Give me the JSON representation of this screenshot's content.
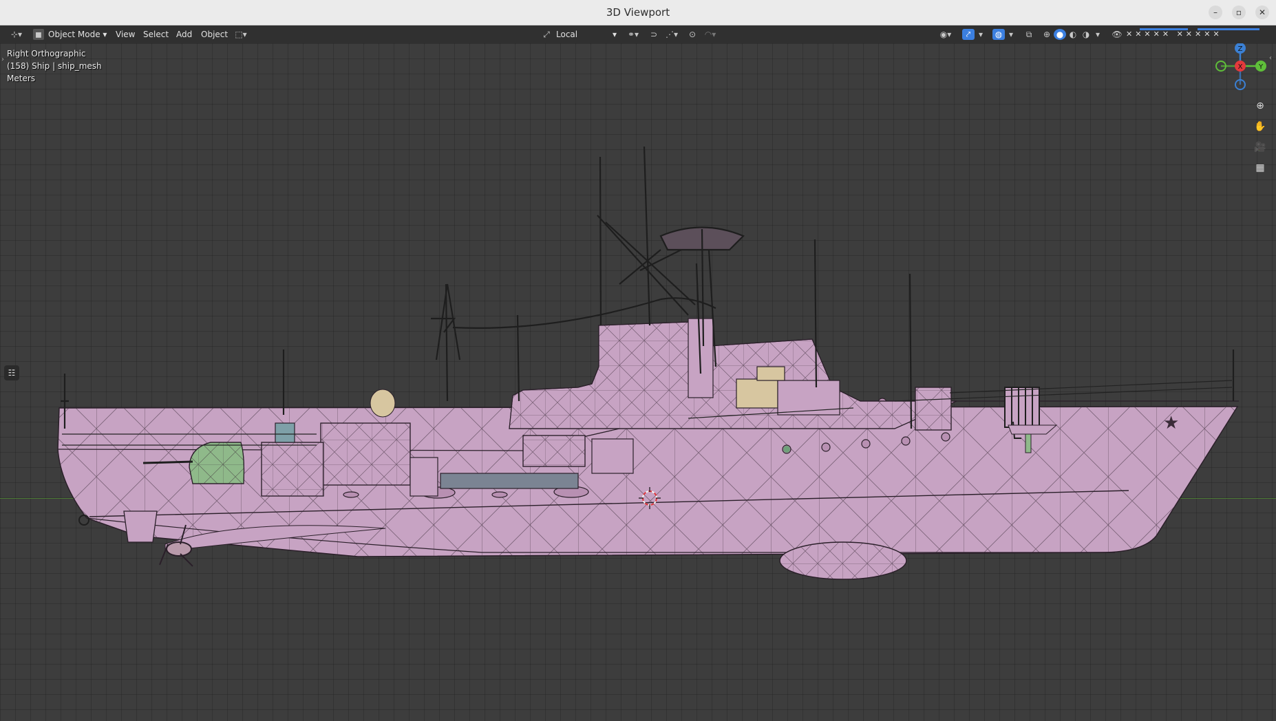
{
  "window": {
    "title": "3D Viewport",
    "minimize": "–",
    "maximize": "▫",
    "close": "✕"
  },
  "header": {
    "mode_label": "Object Mode",
    "menu": [
      "View",
      "Select",
      "Add",
      "Object"
    ],
    "transform_orientation": "Local"
  },
  "overlay_text": {
    "view_name": "Right Orthographic",
    "object_info": "(158) Ship | ship_mesh",
    "units": "Meters"
  },
  "gizmo": {
    "z": "Z",
    "y": "Y",
    "x": "X"
  },
  "icons": {
    "editor_type": "editor-type-icon",
    "mode": "object-mode-icon",
    "orientation": "transform-orientation-icon",
    "snap": "snap-icon",
    "proportional": "proportional-edit-icon",
    "visibility": "visibility-icon",
    "gizmos": "gizmo-icon",
    "overlays": "overlays-icon",
    "xray": "xray-icon",
    "shading": [
      "wireframe-shading-icon",
      "solid-shading-icon",
      "material-shading-icon",
      "rendered-shading-icon"
    ],
    "nav": [
      "zoom-icon",
      "pan-hand-icon",
      "camera-icon",
      "grid-ortho-icon"
    ]
  },
  "colors": {
    "hull": "#c7a3c3",
    "hull_wire": "#2a1f29",
    "turret": "#8fb98a",
    "radar": "#d7c6a0",
    "x_axis": "#e4393c",
    "y_axis": "#5fbf3a",
    "z_axis": "#3b80d4",
    "active_blue": "#3b7fe0"
  }
}
